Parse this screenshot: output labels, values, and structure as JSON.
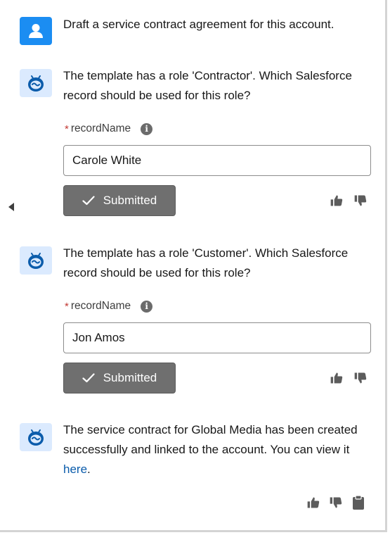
{
  "messages": {
    "user_request": "Draft a service contract agreement for this account.",
    "bot_q1": "The template has a role 'Contractor'. Which Salesforce record should be used for this role?",
    "bot_q2": "The template has a role 'Customer'. Which Salesforce record should be used for this role?",
    "bot_final_text": "The service contract for Global Media has been created successfully and linked to the account. You can view it ",
    "bot_final_link": "here",
    "bot_final_end": "."
  },
  "form1": {
    "label": "recordName",
    "required_marker": "*",
    "value": "Carole White",
    "button": "Submitted"
  },
  "form2": {
    "label": "recordName",
    "required_marker": "*",
    "value": "Jon Amos",
    "button": "Submitted"
  },
  "icons": {
    "user_avatar": "user-avatar-icon",
    "bot_avatar": "einstein-bot-icon",
    "info": "info-icon",
    "check": "check-icon",
    "thumbs_up": "thumbs-up-icon",
    "thumbs_down": "thumbs-down-icon",
    "copy": "clipboard-icon",
    "collapse": "collapse-arrow-icon"
  },
  "colors": {
    "user_avatar_bg": "#1b8df2",
    "bot_avatar_bg": "#dbeafe",
    "bot_icon": "#0b5cab",
    "submitted_button_bg": "#6f6f6f",
    "link": "#0b5cab",
    "required": "#c23934"
  }
}
